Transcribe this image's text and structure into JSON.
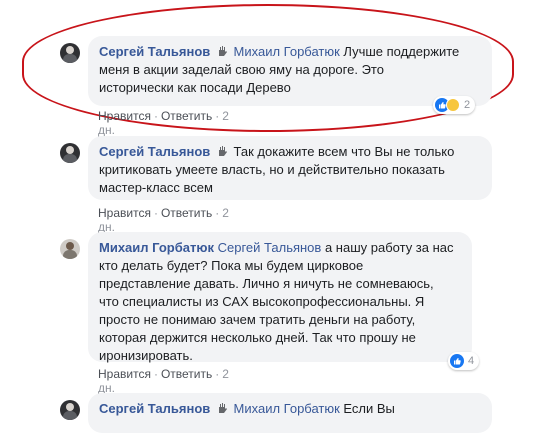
{
  "colors": {
    "link_blue": "#385898",
    "bubble_bg": "#f2f3f5",
    "highlight_red": "#c8141a",
    "like_blue": "#1877f2"
  },
  "comments": [
    {
      "author": "Сергей Тальянов",
      "mention": "Михаил Горбатюк",
      "lines": [
        "Лучше поддержите",
        "меня в акции заделай свою яму на дороге. Это",
        "исторически как посади Дерево"
      ],
      "actions": {
        "like": "Нравится",
        "reply": "Ответить",
        "time": "2 дн."
      },
      "reactions": {
        "icons": [
          "like-icon",
          "haha-icon"
        ],
        "count": "2"
      }
    },
    {
      "author": "Сергей Тальянов",
      "mention": "",
      "lines": [
        "Так докажите всем что Вы не только",
        "критиковать умеете власть, но и действительно показать",
        "мастер-класс всем"
      ],
      "actions": {
        "like": "Нравится",
        "reply": "Ответить",
        "time": "2 дн."
      }
    },
    {
      "author": "Михаил Горбатюк",
      "mention": "Сергей Тальянов",
      "lines": [
        "а нашу работу за нас",
        "кто делать будет? Пока мы будем цирковое",
        "представление давать. Лично я ничуть не сомневаюсь,",
        "что специалисты из САХ высокопрофессиональны. Я",
        "просто не понимаю зачем тратить деньги на работу,",
        "которая держится несколько дней. Так что прошу не",
        "иронизировать."
      ],
      "actions": {
        "like": "Нравится",
        "reply": "Ответить",
        "time": "2 дн."
      },
      "reactions": {
        "icons": [
          "like-icon"
        ],
        "count": "4"
      }
    },
    {
      "author": "Сергей Тальянов",
      "mention": "Михаил Горбатюк",
      "lines": [
        "Если Вы"
      ]
    }
  ]
}
